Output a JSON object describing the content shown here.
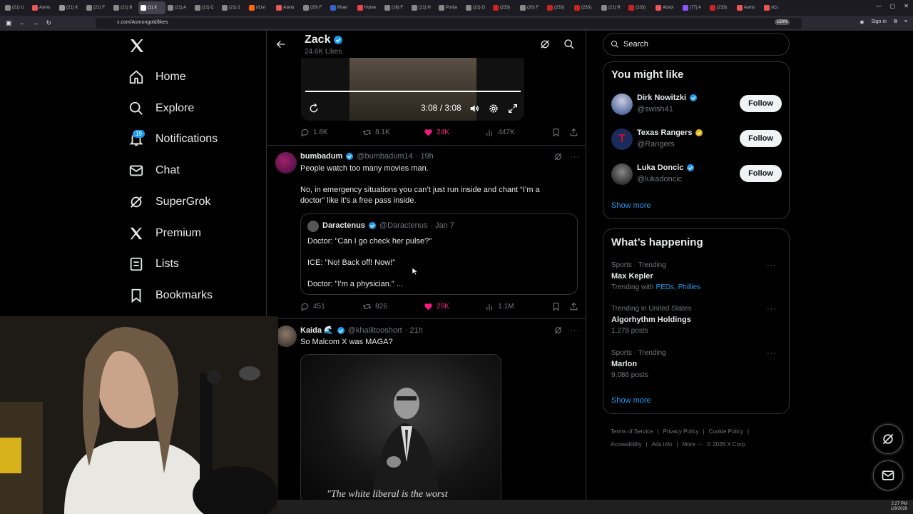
{
  "browser": {
    "tabs": [
      "(21) U",
      "Asmo",
      "(21) K",
      "(21) F",
      "(21) B",
      "(1) X",
      "(21) A",
      "(21) C",
      "(21) 2",
      "r/Livi",
      "Asmo",
      "(20) F",
      "Khan",
      "Home",
      "(18) F",
      "(21) H",
      "Portla",
      "(21) O",
      "(233)",
      "(20) F",
      "(233)",
      "(233)",
      "(21) R",
      "(233)",
      "Absol",
      "(77) A",
      "(233)",
      "Asmo",
      "xCc"
    ],
    "url": "x.com/Asmongold/likes",
    "zoom": "150%",
    "signin": "Sign in"
  },
  "nav": {
    "items": [
      "Home",
      "Explore",
      "Notifications",
      "Chat",
      "SuperGrok",
      "Premium",
      "Lists",
      "Bookmarks"
    ],
    "notif_badge": "19"
  },
  "header": {
    "name": "Zack",
    "likes": "24.6K Likes"
  },
  "video": {
    "time": "3:08 / 3:08"
  },
  "post0_actions": {
    "replies": "1.8K",
    "reposts": "8.1K",
    "likes": "24K",
    "views": "447K"
  },
  "post1": {
    "display_name": "bumbadum",
    "handle": "@bumbadum14",
    "time": "· 19h",
    "line1": "People watch too many movies man.",
    "line2": "No, in emergency situations you can’t just run inside and chant “I’m a",
    "line3": "doctor” like it’s a free pass inside.",
    "quote": {
      "display_name": "Daractenus",
      "handle": "@Daractenus",
      "time": "· Jan 7",
      "l1": "Doctor: \"Can I go check her pulse?\"",
      "l2": "ICE: \"No! Back off! Now!\"",
      "l3": "Doctor: \"I'm a physician.\" ..."
    },
    "actions": {
      "replies": "451",
      "reposts": "826",
      "likes": "25K",
      "views": "1.1M"
    }
  },
  "post2": {
    "display_name": "Kaida 🌊",
    "handle": "@khaliltooshort",
    "time": "· 21h",
    "text": "So Malcom X was MAGA?",
    "image_quote": "\"The white liberal is the worst"
  },
  "right": {
    "search_placeholder": "Search",
    "wtf_title": "You might like",
    "wtf": [
      {
        "name": "Dirk Nowitzki",
        "handle": "@swish41",
        "btn": "Follow",
        "badge": "#1d9bf0"
      },
      {
        "name": "Texas Rangers",
        "handle": "@Rangers",
        "btn": "Follow",
        "badge": "#e2b719"
      },
      {
        "name": "Luka Doncic",
        "handle": "@lukadoncic",
        "btn": "Follow",
        "badge": "#1d9bf0"
      }
    ],
    "show_more": "Show more",
    "happening_title": "What’s happening",
    "trends": [
      {
        "context": "Sports · Trending",
        "title": "Max Kepler",
        "meta_prefix": "Trending with ",
        "link1": "PEDs",
        "sep": ", ",
        "link2": "Phillies"
      },
      {
        "context": "Trending in United States",
        "title": "Algorhythm Holdings",
        "meta": "1,278 posts"
      },
      {
        "context": "Sports · Trending",
        "title": "Marlon",
        "meta": "9,086 posts"
      }
    ],
    "show_more2": "Show more",
    "footer": [
      "Terms of Service",
      "|",
      "Privacy Policy",
      "|",
      "Cookie Policy",
      "|",
      "Accessibility",
      "|",
      "Ads info",
      "|",
      "More ···",
      "© 2026 X Corp."
    ]
  },
  "taskbar": {
    "time": "2:27 PM",
    "date": "1/9/2026"
  },
  "colors": {
    "accent": "#1d9bf0",
    "like": "#f91880",
    "gold": "#e2b719"
  }
}
